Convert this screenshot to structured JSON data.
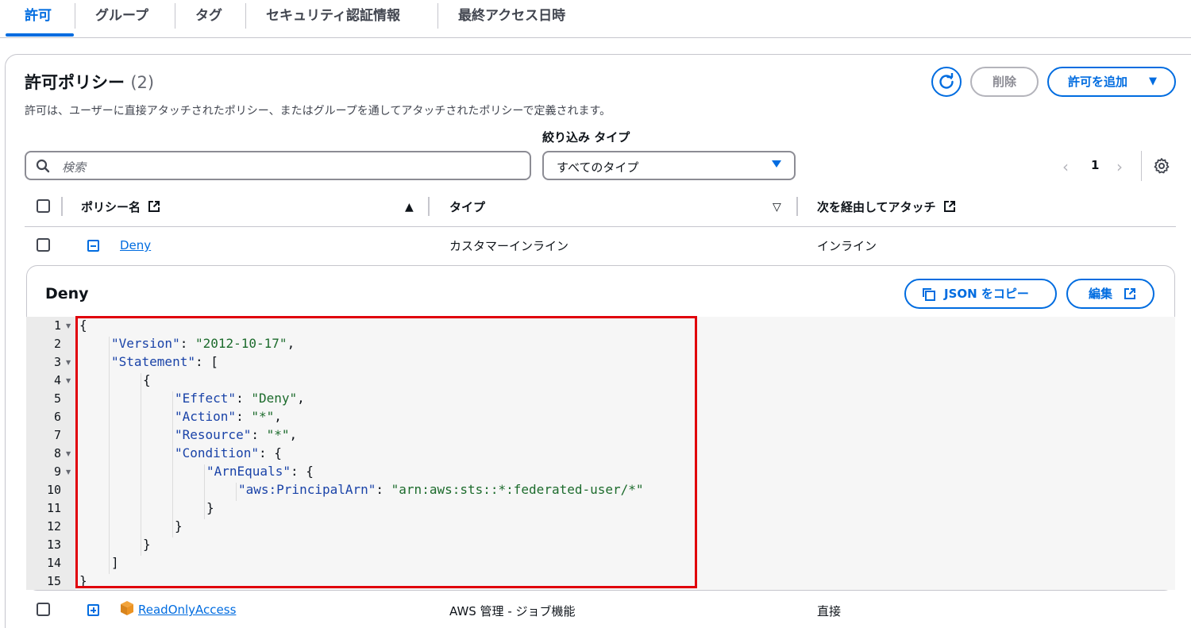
{
  "tabs": [
    {
      "label": "許可",
      "active": true
    },
    {
      "label": "グループ"
    },
    {
      "label": "タグ"
    },
    {
      "label": "セキュリティ認証情報"
    },
    {
      "label": "最終アクセス日時"
    }
  ],
  "section": {
    "title": "許可ポリシー",
    "count": "(2)",
    "description": "許可は、ユーザーに直接アタッチされたポリシー、またはグループを通してアタッチされたポリシーで定義されます。",
    "delete_label": "削除",
    "add_label": "許可を追加"
  },
  "filter": {
    "label": "絞り込み タイプ",
    "search_placeholder": "検索",
    "type_value": "すべてのタイプ"
  },
  "pagination": {
    "page": "1"
  },
  "table": {
    "headers": {
      "name": "ポリシー名",
      "type": "タイプ",
      "attached_via": "次を経由してアタッチ"
    },
    "rows": [
      {
        "name": "Deny",
        "type": "カスタマーインライン",
        "attached_via": "インライン",
        "expanded": true
      },
      {
        "name": "ReadOnlyAccess",
        "type": "AWS 管理 - ジョブ機能",
        "attached_via": "直接",
        "expanded": false
      }
    ]
  },
  "detail": {
    "title": "Deny",
    "copy_label": "JSON をコピー",
    "edit_label": "編集",
    "code_lines": [
      {
        "num": "1",
        "indent": 0,
        "parts": [
          [
            "p",
            "{"
          ]
        ]
      },
      {
        "num": "2",
        "indent": 1,
        "parts": [
          [
            "k",
            "\"Version\""
          ],
          [
            "p",
            ": "
          ],
          [
            "s",
            "\"2012-10-17\""
          ],
          [
            "p",
            ","
          ]
        ]
      },
      {
        "num": "3",
        "indent": 1,
        "parts": [
          [
            "k",
            "\"Statement\""
          ],
          [
            "p",
            ": ["
          ]
        ]
      },
      {
        "num": "4",
        "indent": 2,
        "parts": [
          [
            "p",
            "{"
          ]
        ]
      },
      {
        "num": "5",
        "indent": 3,
        "parts": [
          [
            "k",
            "\"Effect\""
          ],
          [
            "p",
            ": "
          ],
          [
            "s",
            "\"Deny\""
          ],
          [
            "p",
            ","
          ]
        ]
      },
      {
        "num": "6",
        "indent": 3,
        "parts": [
          [
            "k",
            "\"Action\""
          ],
          [
            "p",
            ": "
          ],
          [
            "s",
            "\"*\""
          ],
          [
            "p",
            ","
          ]
        ]
      },
      {
        "num": "7",
        "indent": 3,
        "parts": [
          [
            "k",
            "\"Resource\""
          ],
          [
            "p",
            ": "
          ],
          [
            "s",
            "\"*\""
          ],
          [
            "p",
            ","
          ]
        ]
      },
      {
        "num": "8",
        "indent": 3,
        "parts": [
          [
            "k",
            "\"Condition\""
          ],
          [
            "p",
            ": {"
          ]
        ]
      },
      {
        "num": "9",
        "indent": 4,
        "parts": [
          [
            "k",
            "\"ArnEquals\""
          ],
          [
            "p",
            ": {"
          ]
        ]
      },
      {
        "num": "10",
        "indent": 5,
        "parts": [
          [
            "k",
            "\"aws:PrincipalArn\""
          ],
          [
            "p",
            ": "
          ],
          [
            "s",
            "\"arn:aws:sts::*:federated-user/*\""
          ]
        ]
      },
      {
        "num": "11",
        "indent": 4,
        "parts": [
          [
            "p",
            "}"
          ]
        ]
      },
      {
        "num": "12",
        "indent": 3,
        "parts": [
          [
            "p",
            "}"
          ]
        ]
      },
      {
        "num": "13",
        "indent": 2,
        "parts": [
          [
            "p",
            "}"
          ]
        ]
      },
      {
        "num": "14",
        "indent": 1,
        "parts": [
          [
            "p",
            "]"
          ]
        ]
      },
      {
        "num": "15",
        "indent": 0,
        "parts": [
          [
            "p",
            "}"
          ]
        ]
      }
    ]
  },
  "colors": {
    "accent": "#006ce0",
    "highlight": "#e0000b"
  }
}
